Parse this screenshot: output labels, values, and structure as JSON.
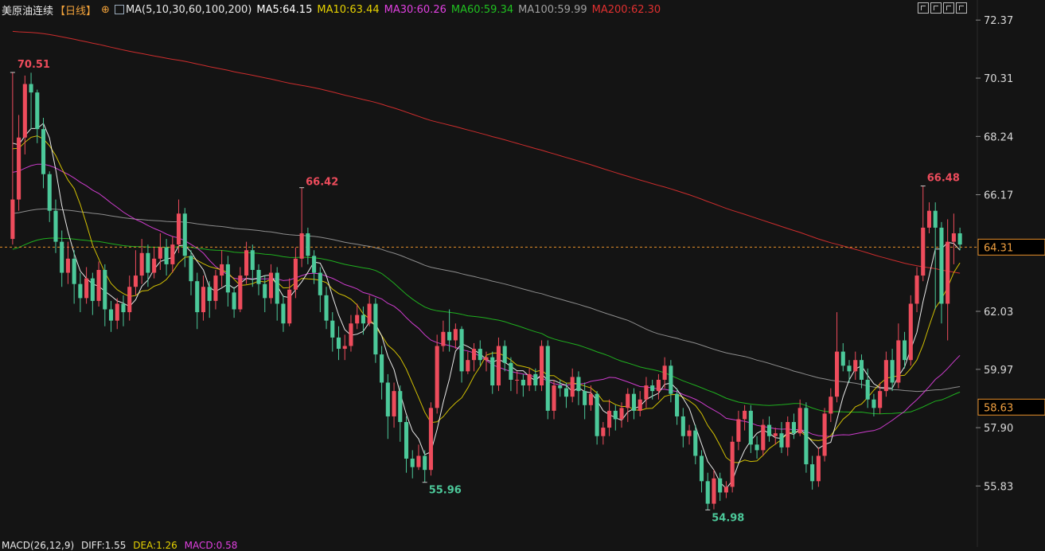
{
  "header": {
    "symbol": "美原油连续",
    "period": "【日线】",
    "ma_params": "MA(5,10,30,60,100,200)",
    "ma_values": [
      {
        "label": "MA5:64.15",
        "color": "#ffffff"
      },
      {
        "label": "MA10:63.44",
        "color": "#e6d200"
      },
      {
        "label": "MA30:60.26",
        "color": "#e040e0"
      },
      {
        "label": "MA60:59.34",
        "color": "#20c020"
      },
      {
        "label": "MA100:59.99",
        "color": "#a0a0a0"
      },
      {
        "label": "MA200:62.30",
        "color": "#e03030"
      }
    ]
  },
  "macd_header": {
    "params": "MACD(26,12,9)",
    "diff": "DIFF:1.55",
    "dea": "DEA:1.26",
    "macd": "MACD:0.58"
  },
  "chart_data": {
    "type": "candlestick",
    "y_ticks": [
      "72.37",
      "70.31",
      "68.24",
      "66.17",
      "62.03",
      "59.97",
      "57.90",
      "55.83"
    ],
    "y_range": [
      54.2,
      72.8
    ],
    "last_price": "64.31",
    "marker_price": "58.63",
    "annotations": {
      "high1": "70.51",
      "high2": "66.42",
      "low1": "55.96",
      "low2": "54.98",
      "high3": "66.48"
    },
    "candles": [
      [
        64.6,
        66.0,
        70.51,
        64.4
      ],
      [
        66.0,
        68.2,
        69.0,
        65.6
      ],
      [
        68.2,
        70.1,
        70.4,
        67.6
      ],
      [
        70.1,
        69.8,
        70.5,
        68.5
      ],
      [
        69.8,
        68.5,
        69.9,
        68.0
      ],
      [
        68.5,
        66.9,
        68.9,
        66.4
      ],
      [
        66.9,
        65.6,
        67.0,
        65.2
      ],
      [
        65.6,
        64.5,
        66.0,
        64.1
      ],
      [
        64.5,
        63.4,
        64.9,
        62.9
      ],
      [
        63.4,
        63.9,
        64.5,
        63.0
      ],
      [
        63.9,
        63.0,
        64.2,
        62.3
      ],
      [
        63.0,
        62.5,
        63.4,
        62.0
      ],
      [
        62.5,
        63.2,
        63.6,
        62.3
      ],
      [
        63.2,
        62.4,
        63.4,
        61.9
      ],
      [
        62.4,
        63.5,
        63.8,
        62.2
      ],
      [
        63.5,
        62.1,
        63.7,
        61.5
      ],
      [
        62.1,
        61.7,
        62.4,
        61.3
      ],
      [
        61.7,
        62.3,
        62.5,
        61.4
      ],
      [
        62.3,
        62.0,
        62.6,
        61.5
      ],
      [
        62.0,
        62.9,
        63.3,
        61.7
      ],
      [
        62.9,
        63.3,
        64.2,
        62.6
      ],
      [
        63.3,
        64.1,
        64.6,
        63.0
      ],
      [
        64.1,
        63.4,
        64.4,
        62.9
      ],
      [
        63.4,
        63.9,
        64.3,
        63.2
      ],
      [
        63.9,
        64.3,
        64.8,
        63.5
      ],
      [
        64.3,
        63.7,
        64.6,
        63.3
      ],
      [
        63.7,
        64.4,
        64.7,
        63.4
      ],
      [
        64.4,
        65.5,
        66.0,
        64.1
      ],
      [
        65.5,
        64.0,
        65.7,
        63.6
      ],
      [
        64.0,
        63.1,
        64.2,
        62.6
      ],
      [
        63.1,
        62.0,
        63.4,
        61.4
      ],
      [
        62.0,
        62.9,
        63.3,
        61.7
      ],
      [
        62.9,
        62.4,
        63.1,
        61.8
      ],
      [
        62.4,
        63.3,
        63.5,
        62.1
      ],
      [
        63.3,
        63.7,
        64.2,
        62.9
      ],
      [
        63.7,
        62.7,
        64.0,
        62.2
      ],
      [
        62.7,
        62.1,
        62.9,
        61.8
      ],
      [
        62.1,
        63.3,
        63.6,
        62.0
      ],
      [
        63.3,
        64.2,
        64.5,
        63.0
      ],
      [
        64.2,
        63.5,
        64.4,
        62.9
      ],
      [
        63.5,
        63.0,
        63.7,
        62.6
      ],
      [
        63.0,
        62.5,
        63.3,
        62.0
      ],
      [
        62.5,
        63.4,
        63.7,
        62.3
      ],
      [
        63.4,
        62.3,
        63.6,
        61.7
      ],
      [
        62.3,
        61.6,
        62.6,
        61.3
      ],
      [
        61.6,
        62.8,
        63.2,
        61.5
      ],
      [
        62.8,
        63.9,
        64.3,
        62.5
      ],
      [
        63.9,
        64.8,
        66.42,
        63.6
      ],
      [
        64.8,
        64.0,
        65.0,
        63.7
      ],
      [
        64.0,
        63.4,
        64.2,
        63.0
      ],
      [
        63.4,
        62.6,
        63.6,
        62.0
      ],
      [
        62.6,
        61.7,
        62.9,
        61.4
      ],
      [
        61.7,
        61.1,
        62.0,
        60.6
      ],
      [
        61.1,
        60.7,
        61.5,
        60.3
      ],
      [
        60.7,
        60.8,
        61.2,
        60.3
      ],
      [
        60.8,
        61.6,
        61.9,
        60.6
      ],
      [
        61.6,
        61.9,
        62.3,
        61.4
      ],
      [
        61.9,
        61.6,
        62.2,
        61.2
      ],
      [
        61.6,
        62.3,
        62.6,
        61.5
      ],
      [
        62.3,
        60.5,
        62.5,
        60.2
      ],
      [
        60.5,
        59.5,
        60.8,
        58.9
      ],
      [
        59.5,
        58.3,
        59.8,
        57.5
      ],
      [
        58.3,
        59.2,
        59.5,
        57.9
      ],
      [
        59.2,
        58.1,
        59.4,
        57.4
      ],
      [
        58.1,
        56.8,
        58.3,
        56.3
      ],
      [
        56.8,
        56.5,
        57.1,
        56.1
      ],
      [
        56.5,
        56.9,
        57.3,
        56.4
      ],
      [
        56.9,
        56.4,
        57.1,
        55.96
      ],
      [
        56.4,
        58.6,
        58.8,
        56.2
      ],
      [
        58.6,
        60.8,
        61.2,
        58.4
      ],
      [
        60.8,
        61.3,
        61.7,
        60.6
      ],
      [
        61.3,
        61.0,
        62.1,
        60.6
      ],
      [
        61.0,
        61.4,
        61.6,
        60.7
      ],
      [
        61.4,
        59.9,
        61.5,
        59.5
      ],
      [
        59.9,
        60.3,
        60.6,
        59.8
      ],
      [
        60.3,
        60.7,
        60.9,
        59.9
      ],
      [
        60.7,
        60.3,
        61.0,
        60.1
      ],
      [
        60.3,
        60.4,
        60.6,
        59.9
      ],
      [
        60.4,
        59.4,
        60.6,
        59.1
      ],
      [
        59.4,
        60.8,
        61.1,
        59.2
      ],
      [
        60.8,
        60.2,
        61.0,
        59.9
      ],
      [
        60.2,
        59.6,
        60.4,
        59.2
      ],
      [
        59.6,
        59.6,
        59.9,
        59.1
      ],
      [
        59.6,
        59.4,
        59.8,
        59.0
      ],
      [
        59.4,
        59.8,
        60.0,
        59.2
      ],
      [
        59.8,
        59.4,
        60.0,
        59.2
      ],
      [
        59.4,
        60.8,
        61.0,
        59.2
      ],
      [
        60.8,
        58.5,
        61.0,
        58.2
      ],
      [
        58.5,
        59.4,
        59.6,
        58.2
      ],
      [
        59.4,
        59.3,
        59.6,
        59.0
      ],
      [
        59.3,
        59.0,
        59.5,
        58.6
      ],
      [
        59.0,
        59.7,
        60.0,
        58.8
      ],
      [
        59.7,
        59.2,
        59.9,
        58.7
      ],
      [
        59.2,
        58.7,
        59.5,
        58.2
      ],
      [
        58.7,
        59.1,
        59.4,
        58.5
      ],
      [
        59.1,
        57.6,
        59.2,
        57.3
      ],
      [
        57.6,
        57.9,
        58.1,
        57.3
      ],
      [
        57.9,
        58.5,
        58.9,
        57.6
      ],
      [
        58.5,
        58.2,
        58.7,
        57.8
      ],
      [
        58.2,
        58.6,
        58.8,
        57.9
      ],
      [
        58.6,
        59.1,
        59.3,
        58.1
      ],
      [
        59.1,
        58.5,
        59.3,
        58.2
      ],
      [
        58.5,
        58.9,
        59.2,
        58.3
      ],
      [
        58.9,
        59.4,
        59.7,
        58.6
      ],
      [
        59.4,
        59.2,
        59.6,
        58.9
      ],
      [
        59.2,
        59.6,
        59.8,
        58.9
      ],
      [
        59.6,
        60.1,
        60.4,
        59.3
      ],
      [
        60.1,
        59.1,
        60.3,
        58.8
      ],
      [
        59.1,
        58.3,
        59.3,
        58.0
      ],
      [
        58.3,
        57.6,
        58.6,
        57.2
      ],
      [
        57.6,
        57.8,
        58.0,
        57.3
      ],
      [
        57.8,
        56.9,
        58.0,
        56.6
      ],
      [
        56.9,
        56.0,
        57.1,
        55.6
      ],
      [
        56.0,
        55.2,
        56.3,
        54.98
      ],
      [
        55.2,
        56.1,
        56.4,
        55.0
      ],
      [
        56.1,
        55.6,
        56.3,
        55.3
      ],
      [
        55.6,
        55.8,
        56.0,
        55.4
      ],
      [
        55.8,
        57.4,
        57.6,
        55.6
      ],
      [
        57.4,
        58.2,
        58.5,
        57.1
      ],
      [
        58.2,
        58.5,
        58.7,
        57.8
      ],
      [
        58.5,
        57.3,
        58.7,
        57.0
      ],
      [
        57.3,
        57.1,
        57.6,
        56.8
      ],
      [
        57.1,
        58.0,
        58.2,
        56.9
      ],
      [
        58.0,
        57.6,
        58.3,
        57.4
      ],
      [
        57.6,
        57.7,
        57.9,
        57.3
      ],
      [
        57.7,
        57.2,
        58.1,
        57.0
      ],
      [
        57.2,
        58.1,
        58.3,
        56.9
      ],
      [
        58.1,
        57.7,
        58.4,
        57.5
      ],
      [
        57.7,
        58.6,
        58.9,
        57.6
      ],
      [
        58.6,
        56.6,
        58.8,
        56.3
      ],
      [
        56.6,
        56.0,
        56.9,
        55.7
      ],
      [
        56.0,
        56.9,
        57.2,
        55.8
      ],
      [
        56.9,
        58.4,
        58.6,
        56.7
      ],
      [
        58.4,
        59.0,
        59.3,
        58.1
      ],
      [
        59.0,
        60.6,
        62.0,
        58.8
      ],
      [
        60.6,
        60.1,
        60.9,
        59.9
      ],
      [
        60.1,
        59.9,
        60.3,
        59.5
      ],
      [
        59.9,
        60.3,
        60.6,
        59.6
      ],
      [
        60.3,
        59.6,
        60.5,
        59.3
      ],
      [
        59.6,
        58.9,
        60.0,
        58.6
      ],
      [
        58.9,
        58.6,
        59.1,
        58.3
      ],
      [
        58.6,
        59.2,
        59.5,
        58.4
      ],
      [
        59.2,
        60.3,
        60.6,
        59.0
      ],
      [
        60.3,
        59.5,
        60.7,
        59.2
      ],
      [
        59.5,
        61.0,
        61.6,
        59.3
      ],
      [
        61.0,
        60.3,
        61.3,
        60.0
      ],
      [
        60.3,
        62.3,
        62.6,
        60.1
      ],
      [
        62.3,
        63.3,
        63.6,
        62.0
      ],
      [
        63.3,
        65.0,
        66.48,
        63.1
      ],
      [
        65.0,
        65.6,
        65.9,
        64.8
      ],
      [
        65.6,
        65.0,
        65.9,
        62.1
      ],
      [
        65.0,
        62.3,
        65.2,
        61.6
      ],
      [
        62.3,
        64.5,
        65.3,
        61.0
      ],
      [
        64.5,
        64.8,
        65.5,
        63.7
      ],
      [
        64.8,
        64.4,
        65.0,
        64.2
      ]
    ]
  }
}
